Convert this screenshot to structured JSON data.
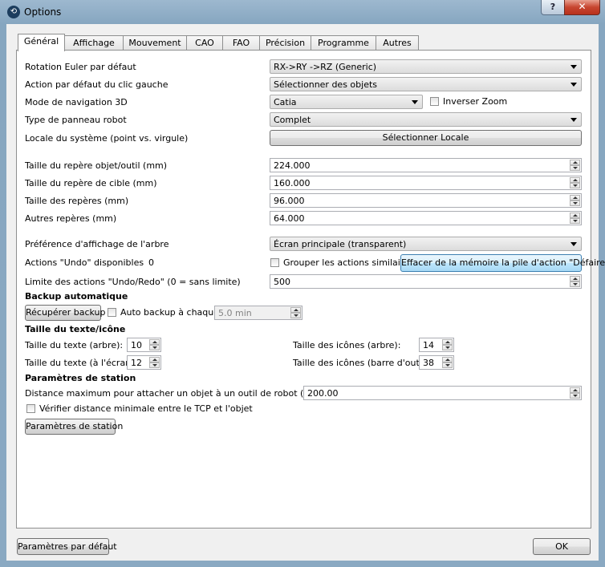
{
  "window": {
    "title": "Options",
    "help": "?",
    "close": "✕"
  },
  "tabs": [
    "Général",
    "Affichage",
    "Mouvement",
    "CAO",
    "FAO",
    "Précision",
    "Programme",
    "Autres"
  ],
  "general": {
    "euler_label": "Rotation Euler par défaut",
    "euler_value": "RX->RY ->RZ  (Generic)",
    "leftclick_label": "Action par défaut du clic gauche",
    "leftclick_value": "Sélectionner des objets",
    "nav_label": "Mode de navigation 3D",
    "nav_value": "Catia",
    "invert_zoom": "Inverser Zoom",
    "robot_panel_label": "Type de panneau robot",
    "robot_panel_value": "Complet",
    "locale_label": "Locale du système (point vs. virgule)",
    "locale_button": "Sélectionner Locale",
    "obj_frame_label": "Taille du repère objet/outil (mm)",
    "obj_frame_value": "224.000",
    "target_frame_label": "Taille du repère de cible (mm)",
    "target_frame_value": "160.000",
    "frames_label": "Taille des repères (mm)",
    "frames_value": "96.000",
    "other_frames_label": "Autres repères (mm)",
    "other_frames_value": "64.000",
    "tree_pref_label": "Préférence d'affichage de l'arbre",
    "tree_pref_value": "Écran principale (transparent)",
    "undo_label": "Actions \"Undo\" disponibles",
    "undo_count": "0",
    "group_actions": "Grouper les actions similaires",
    "clear_undo_button": "Effacer de la mémoire la pile d'action \"Défaire\"",
    "undo_limit_label": "Limite des actions \"Undo/Redo\" (0 = sans limite)",
    "undo_limit_value": "500"
  },
  "backup": {
    "header": "Backup automatique",
    "recover_button": "Récupérer backup",
    "auto_label": "Auto backup à chaque",
    "auto_value": "5.0 min"
  },
  "text_size": {
    "header": "Taille du texte/icône",
    "tree_text_label": "Taille du texte (arbre):",
    "tree_text_value": "10",
    "screen_text_label": "Taille du texte (à l'écran):",
    "screen_text_value": "12",
    "tree_icon_label": "Taille des icônes (arbre):",
    "tree_icon_value": "14",
    "toolbar_icon_label": "Taille des icônes (barre d'outils):",
    "toolbar_icon_value": "38"
  },
  "station": {
    "header": "Paramètres de station",
    "attach_label": "Distance maximum pour attacher un objet à un outil de robot (mm)",
    "attach_value": "200.00",
    "verify_label": "Vérifier distance minimale entre le TCP et l'objet",
    "params_button": "Paramètres de station"
  },
  "footer": {
    "defaults_button": "Paramètres par défaut",
    "ok_button": "OK"
  }
}
